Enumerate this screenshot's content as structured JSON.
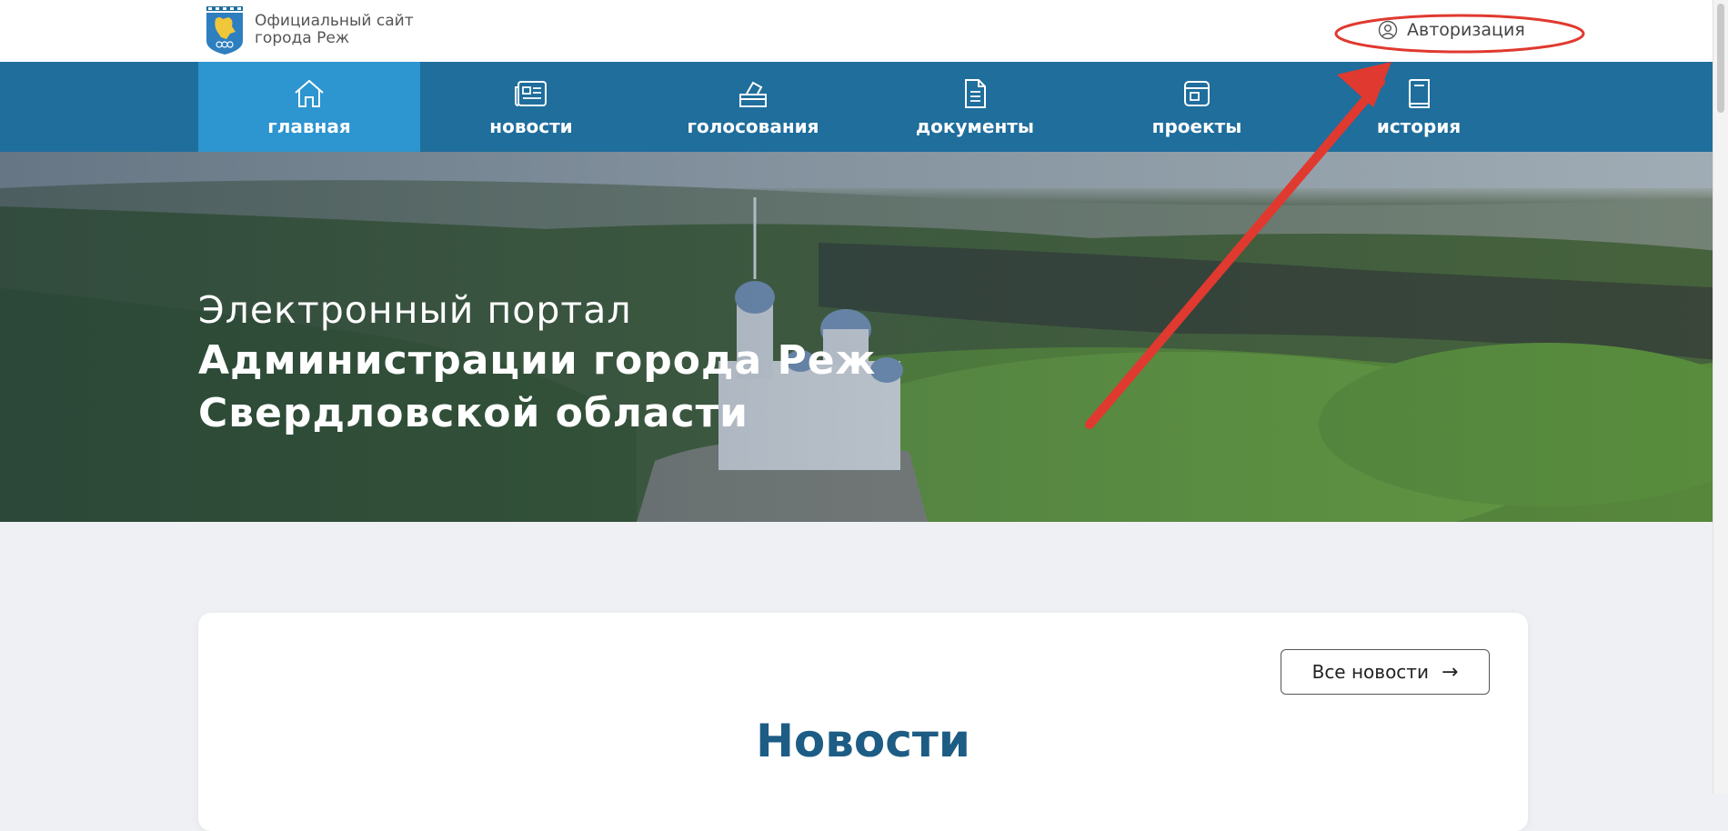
{
  "header": {
    "site_title_line1": "Официальный сайт",
    "site_title_line2": "города Реж",
    "auth_label": "Авторизация"
  },
  "nav": {
    "items": [
      {
        "label": "главная",
        "icon": "home-icon",
        "active": true
      },
      {
        "label": "новости",
        "icon": "newspaper-icon",
        "active": false
      },
      {
        "label": "голосования",
        "icon": "ballot-box-icon",
        "active": false
      },
      {
        "label": "документы",
        "icon": "document-icon",
        "active": false
      },
      {
        "label": "проекты",
        "icon": "project-window-icon",
        "active": false
      },
      {
        "label": "история",
        "icon": "book-icon",
        "active": false
      }
    ]
  },
  "hero": {
    "line1": "Электронный портал",
    "line2": "Администрации города Реж",
    "line3": "Свердловской области"
  },
  "news": {
    "all_news_label": "Все новости",
    "title": "Новости"
  },
  "colors": {
    "nav_bg": "#1f6e9c",
    "nav_active_bg": "#2d95cf",
    "news_title": "#1d5c84",
    "annotation_red": "#e0392f"
  }
}
